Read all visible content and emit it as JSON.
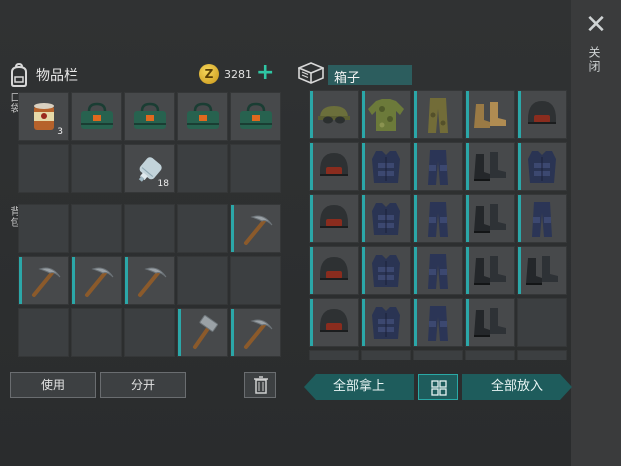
{
  "close_label": "关闭",
  "inventory": {
    "title": "物品栏",
    "coins": "3281",
    "pocket_label": "口袋",
    "backpack_label": "背包",
    "pocket_slots": [
      {
        "item": "canned-food-icon",
        "qty": "3"
      },
      {
        "item": "green-bag-icon",
        "qty": ""
      },
      {
        "item": "green-bag-icon",
        "qty": ""
      },
      {
        "item": "green-bag-icon",
        "qty": ""
      },
      {
        "item": "green-bag-icon",
        "qty": ""
      },
      {
        "item": "",
        "qty": ""
      },
      {
        "item": "",
        "qty": ""
      },
      {
        "item": "water-bottle-icon",
        "qty": "18"
      },
      {
        "item": "",
        "qty": ""
      },
      {
        "item": "",
        "qty": ""
      }
    ],
    "backpack_slots": [
      {
        "item": "",
        "qty": ""
      },
      {
        "item": "",
        "qty": ""
      },
      {
        "item": "",
        "qty": ""
      },
      {
        "item": "",
        "qty": ""
      },
      {
        "item": "pickaxe-icon",
        "qty": ""
      },
      {
        "item": "pickaxe-icon",
        "qty": ""
      },
      {
        "item": "pickaxe-icon",
        "qty": ""
      },
      {
        "item": "pickaxe-icon",
        "qty": ""
      },
      {
        "item": "",
        "qty": ""
      },
      {
        "item": "",
        "qty": ""
      },
      {
        "item": "",
        "qty": ""
      },
      {
        "item": "",
        "qty": ""
      },
      {
        "item": "",
        "qty": ""
      },
      {
        "item": "hammer-icon",
        "qty": ""
      },
      {
        "item": "pickaxe-icon",
        "qty": ""
      }
    ],
    "use_button": "使用",
    "split_button": "分开"
  },
  "box": {
    "title": "箱子",
    "slots": [
      {
        "item": "goggles-cap-icon"
      },
      {
        "item": "camo-jacket-icon"
      },
      {
        "item": "camo-pants-icon"
      },
      {
        "item": "brown-boots-icon"
      },
      {
        "item": "helmet-icon"
      },
      {
        "item": "helmet-icon"
      },
      {
        "item": "armor-vest-icon"
      },
      {
        "item": "armor-pants-icon"
      },
      {
        "item": "black-boots-icon"
      },
      {
        "item": "armor-vest-icon"
      },
      {
        "item": "helmet-icon"
      },
      {
        "item": "armor-vest-icon"
      },
      {
        "item": "armor-pants-icon"
      },
      {
        "item": "black-boots-icon"
      },
      {
        "item": "armor-pants-icon"
      },
      {
        "item": "helmet-icon"
      },
      {
        "item": "armor-vest-icon"
      },
      {
        "item": "armor-pants-icon"
      },
      {
        "item": "black-boots-icon"
      },
      {
        "item": "black-boots-icon"
      },
      {
        "item": "helmet-icon"
      },
      {
        "item": "armor-vest-icon"
      },
      {
        "item": "armor-pants-icon"
      },
      {
        "item": "black-boots-icon"
      },
      {
        "item": ""
      }
    ],
    "take_all_button": "全部拿上",
    "put_all_button": "全部放入"
  },
  "colors": {
    "accent": "#2ba7a8",
    "teal_button": "#1e5c5c",
    "slot": "#3c3f41",
    "coin": "#e2b42e"
  }
}
